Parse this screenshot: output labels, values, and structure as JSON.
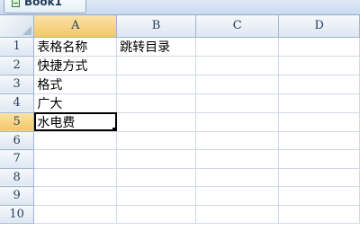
{
  "workbook": {
    "title": "Book1",
    "icon": "excel-workbook-icon"
  },
  "columns": [
    "A",
    "B",
    "C",
    "D"
  ],
  "rows": [
    "1",
    "2",
    "3",
    "4",
    "5",
    "6",
    "7",
    "8",
    "9",
    "10"
  ],
  "cells": {
    "A1": "表格名称",
    "B1": "跳转目录",
    "A2": "快捷方式",
    "A3": "格式",
    "A4": "广大",
    "A5": "水电费"
  },
  "active_cell": "A5",
  "colors": {
    "selection_header": "#f4c66a",
    "gridline": "#d0d7e5",
    "header_border": "#9eb6ce"
  }
}
